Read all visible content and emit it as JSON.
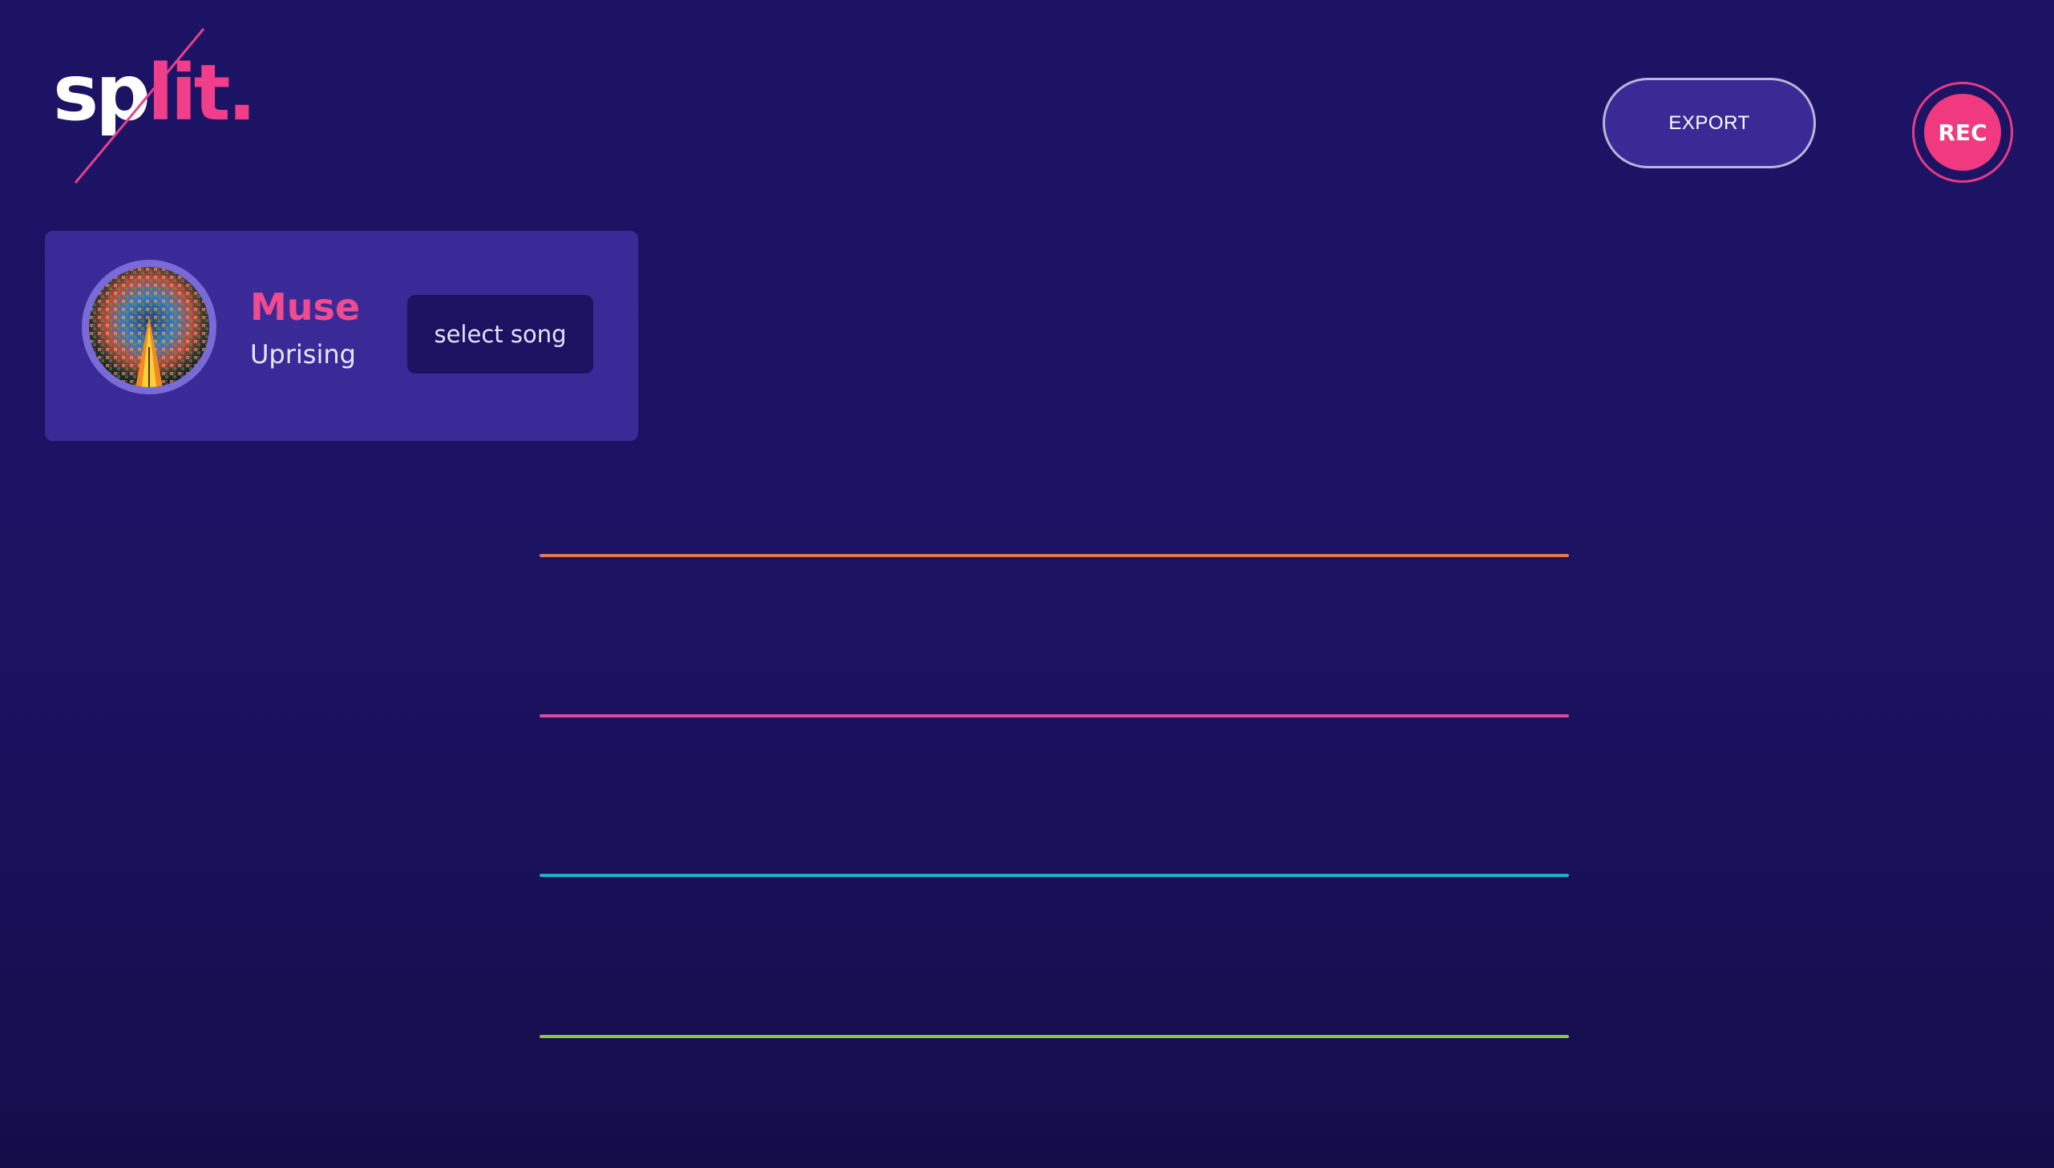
{
  "logo": {
    "text_main": "sp",
    "text_accent": "lit."
  },
  "header": {
    "export_label": "EXPORT",
    "rec_label": "REC"
  },
  "song_card": {
    "artist": "Muse",
    "title": "Uprising",
    "select_label": "select song",
    "album_art_icon": "album-art-image"
  },
  "tracks": [
    {
      "color": "#e8774e"
    },
    {
      "color": "#e4449b"
    },
    {
      "color": "#19b2bd"
    },
    {
      "color": "#8cc63c"
    }
  ],
  "colors": {
    "background": "#1c1365",
    "accent_pink": "#f0397f",
    "card": "#3a2a98",
    "export_button": "#3b2a96",
    "select_button": "#1d1261"
  }
}
